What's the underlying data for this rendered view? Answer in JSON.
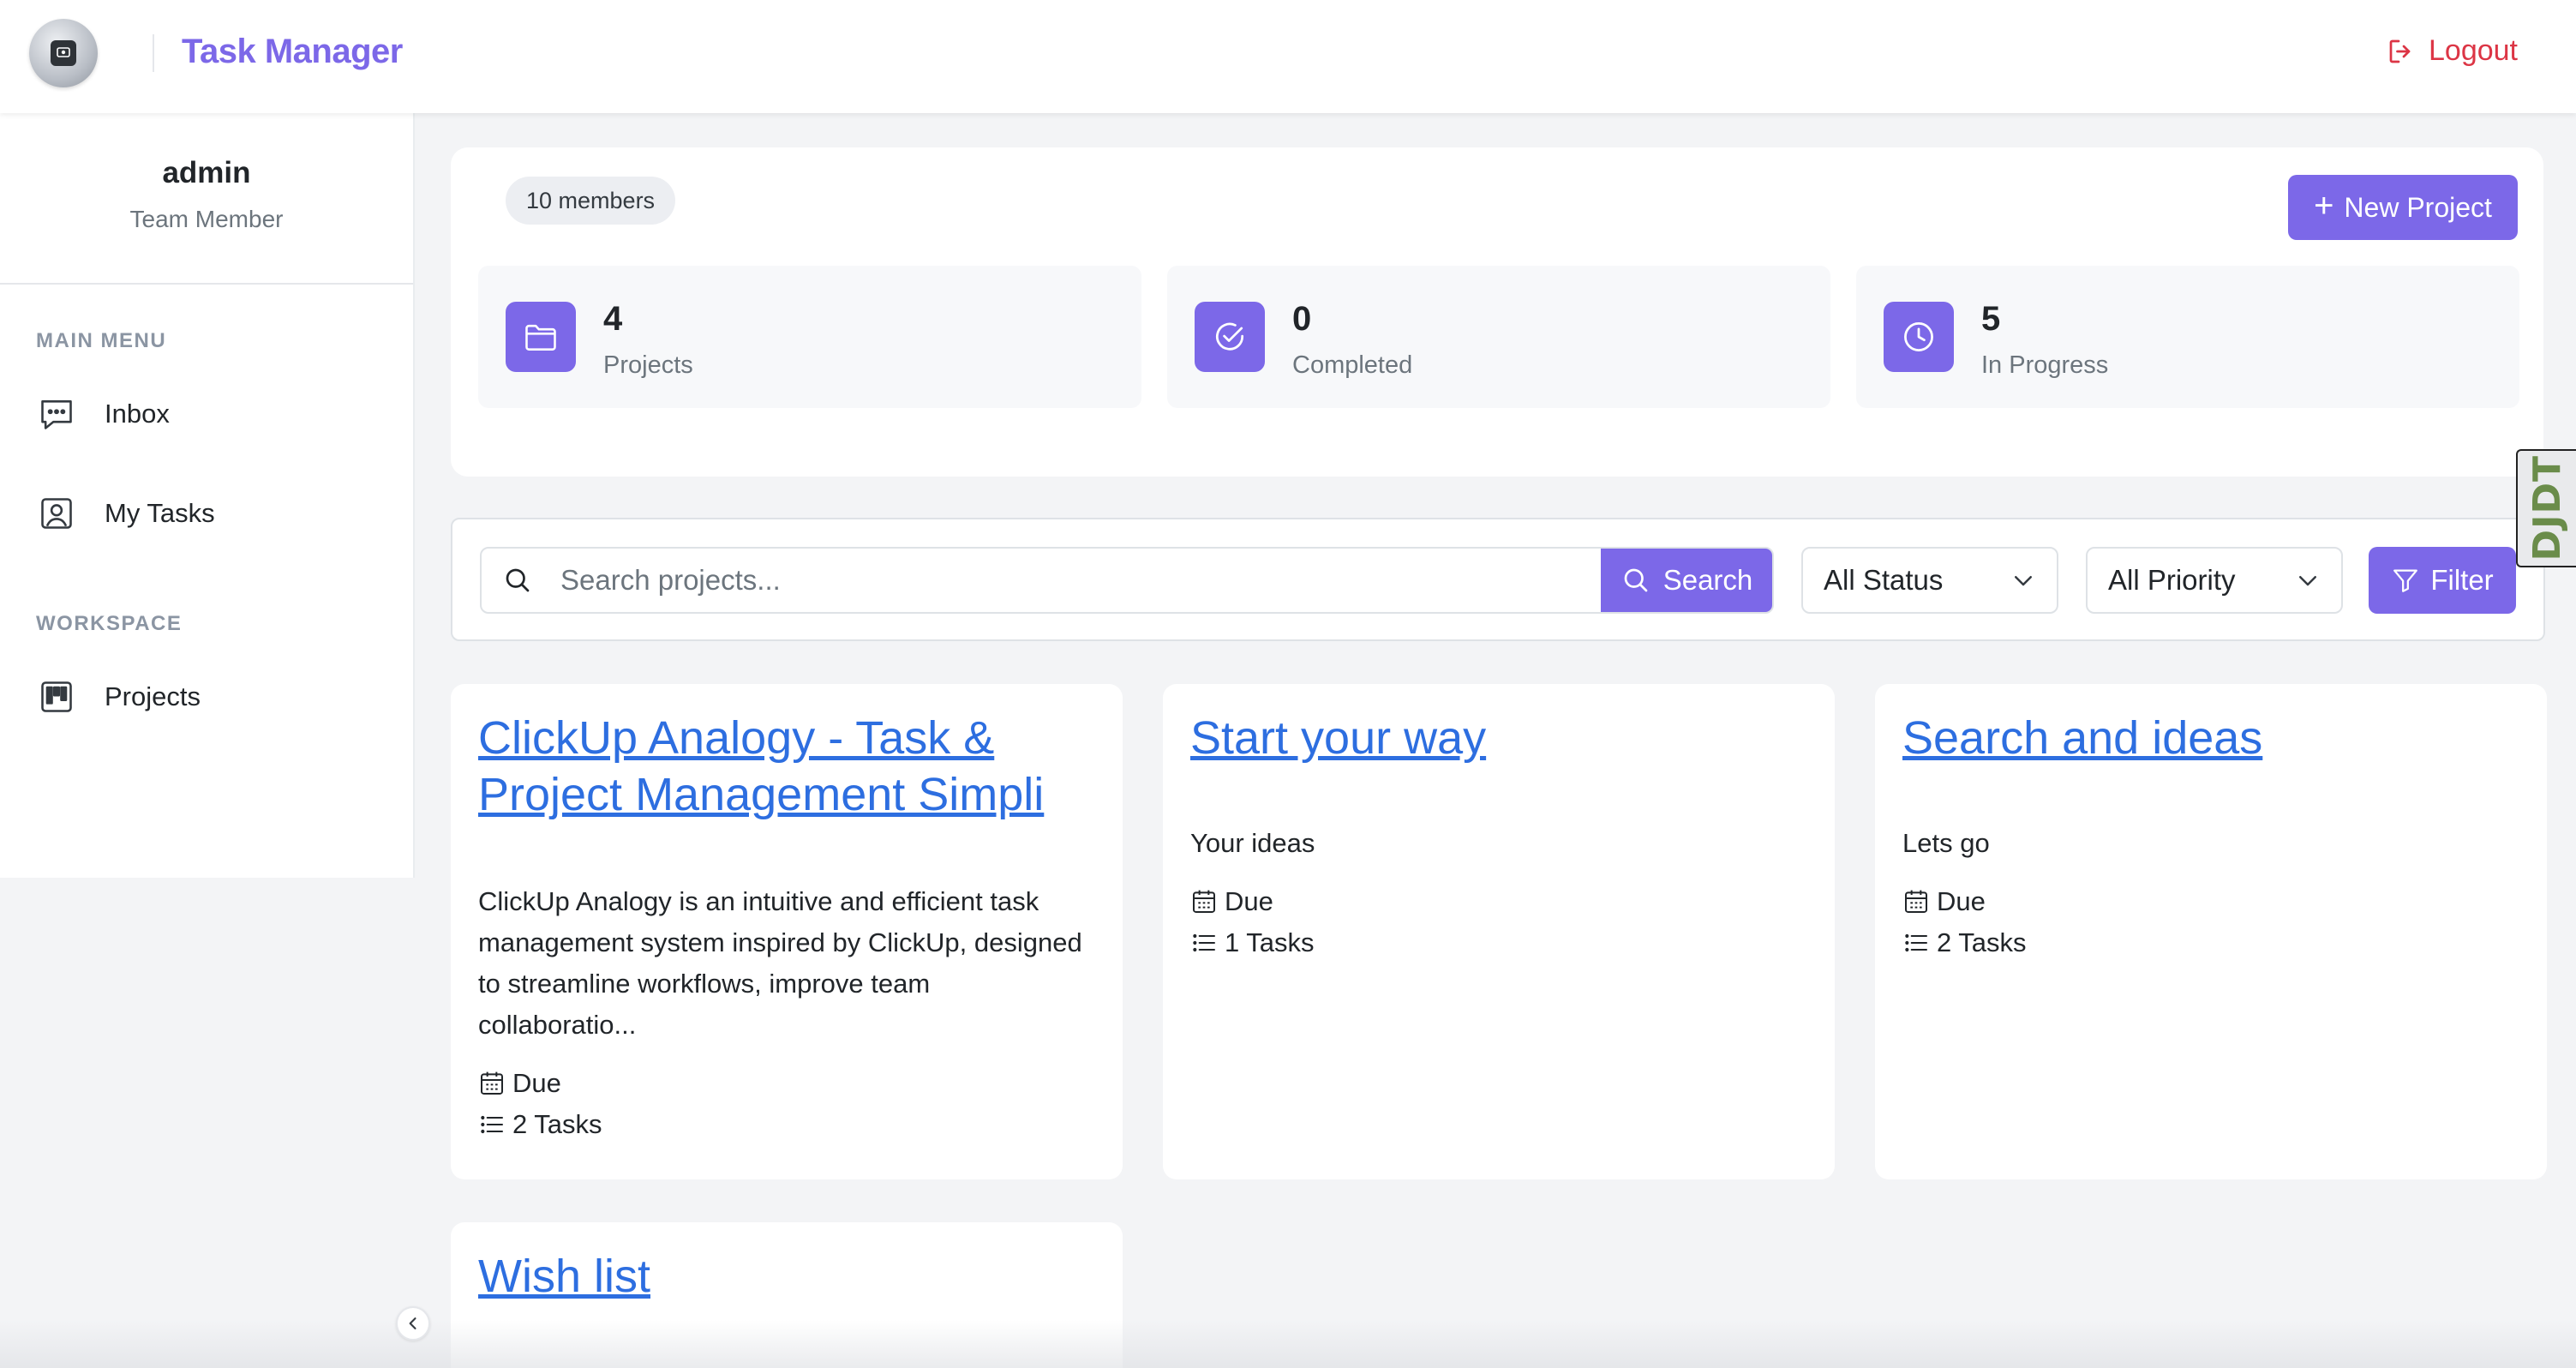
{
  "header": {
    "brand": "Task Manager",
    "logout_label": "Logout"
  },
  "sidebar": {
    "profile": {
      "name": "admin",
      "role": "Team Member"
    },
    "sections": [
      {
        "title": "MAIN MENU",
        "items": [
          {
            "label": "Inbox",
            "icon": "chat-icon"
          },
          {
            "label": "My Tasks",
            "icon": "user-square-icon"
          }
        ]
      },
      {
        "title": "WORKSPACE",
        "items": [
          {
            "label": "Projects",
            "icon": "kanban-icon"
          }
        ]
      }
    ]
  },
  "overview": {
    "members_badge": "10 members",
    "new_project_label": "New Project",
    "stats": [
      {
        "value": "4",
        "label": "Projects",
        "icon": "folder-icon"
      },
      {
        "value": "0",
        "label": "Completed",
        "icon": "check-circle-icon"
      },
      {
        "value": "5",
        "label": "In Progress",
        "icon": "clock-icon"
      }
    ]
  },
  "filters": {
    "search_placeholder": "Search projects...",
    "search_label": "Search",
    "status_value": "All Status",
    "priority_value": "All Priority",
    "filter_label": "Filter"
  },
  "projects": [
    {
      "title": "ClickUp Analogy - Task & Project Management Simpli",
      "description": "ClickUp Analogy is an intuitive and efficient task management system inspired by ClickUp, designed to streamline workflows, improve team collaboratio...",
      "due_label": "Due",
      "tasks_label": "2 Tasks"
    },
    {
      "title": "Start your way",
      "description": "Your ideas",
      "due_label": "Due",
      "tasks_label": "1 Tasks"
    },
    {
      "title": "Search and ideas",
      "description": "Lets go",
      "due_label": "Due",
      "tasks_label": "2 Tasks"
    },
    {
      "title": "Wish list",
      "description": "",
      "due_label": "",
      "tasks_label": ""
    }
  ],
  "debug_toolbar": {
    "label": "DJDT"
  },
  "colors": {
    "accent": "#7c68e8",
    "link": "#2d6ee0",
    "danger": "#dc3545",
    "page_bg": "#f3f4f6"
  }
}
